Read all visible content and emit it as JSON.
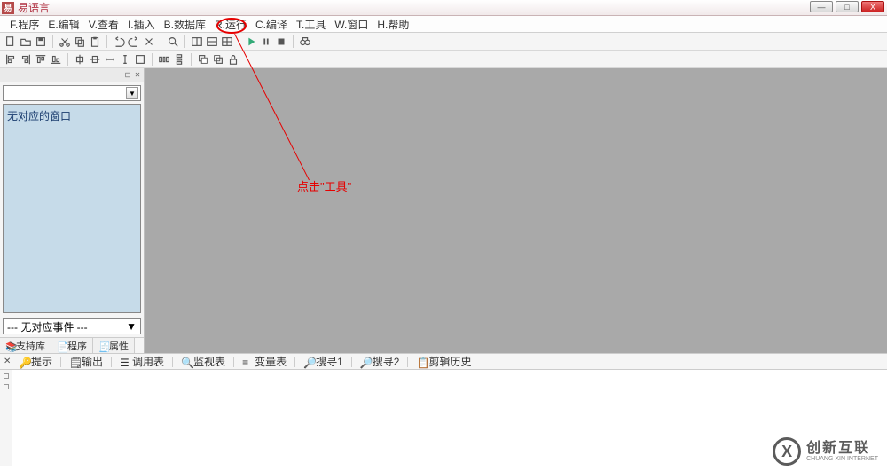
{
  "title": "易语言",
  "menus": [
    "F.程序",
    "E.编辑",
    "V.查看",
    "I.插入",
    "B.数据库",
    "R.运行",
    "C.编译",
    "T.工具",
    "W.窗口",
    "H.帮助"
  ],
  "left_panel": {
    "combo1_value": "",
    "listbox_text": "无对应的窗口",
    "combo2_value": "--- 无对应事件 ---",
    "tabs": [
      "支持库",
      "程序",
      "属性"
    ]
  },
  "annotation": {
    "text": "点击\"工具\""
  },
  "output_tabs": [
    "提示",
    "输出",
    "调用表",
    "监视表",
    "变量表",
    "搜寻1",
    "搜寻2",
    "剪辑历史"
  ],
  "watermark": {
    "big": "创新互联",
    "small": "CHUANG XIN INTERNET"
  },
  "window_buttons": {
    "min": "—",
    "max": "□",
    "close": "X"
  }
}
